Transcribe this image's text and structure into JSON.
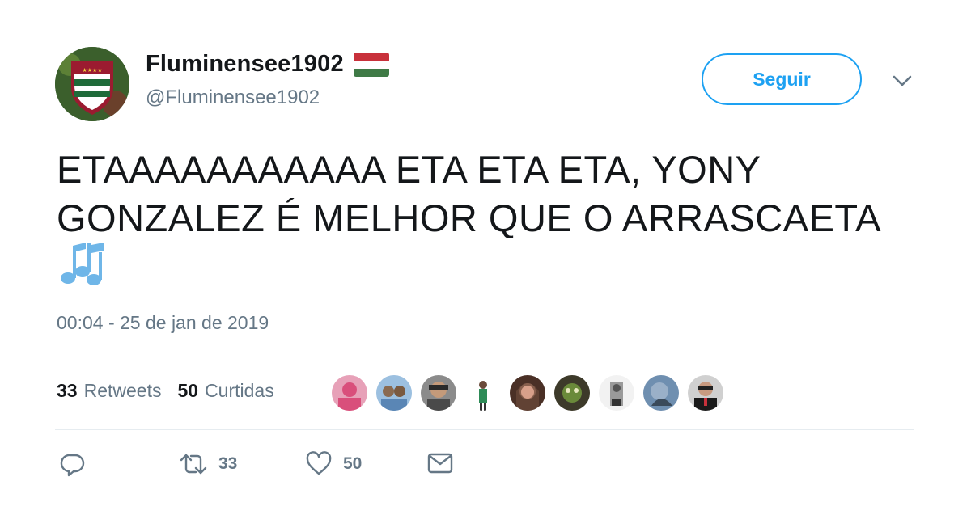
{
  "author": {
    "display_name": "Fluminensee1902",
    "handle": "@Fluminensee1902",
    "avatar_icon": "fluminense-crest-icon",
    "flag_icon": "hungary-flag-icon"
  },
  "follow_button": {
    "label": "Seguir"
  },
  "tweet": {
    "text_line_1": "ETAAAAAAAAAAA ETA ETA ETA, YONY",
    "text_line_2": "GONZALEZ É MELHOR QUE O ARRASCAETA",
    "emoji": "musical-notes-icon",
    "timestamp": "00:04 - 25 de jan de 2019"
  },
  "stats": {
    "retweets_count": "33",
    "retweets_label": "Retweets",
    "likes_count": "50",
    "likes_label": "Curtidas"
  },
  "likers": [
    {
      "name": "liker-avatar-1",
      "color": "#d94f7b"
    },
    {
      "name": "liker-avatar-2",
      "color": "#5a86b5"
    },
    {
      "name": "liker-avatar-3",
      "color": "#4a4a4a"
    },
    {
      "name": "liker-avatar-4",
      "color": "#2e8b57"
    },
    {
      "name": "liker-avatar-5",
      "color": "#6b4a3a"
    },
    {
      "name": "liker-avatar-6",
      "color": "#3d3a2a"
    },
    {
      "name": "liker-avatar-7",
      "color": "#bfbfbf"
    },
    {
      "name": "liker-avatar-8",
      "color": "#6f8fb0"
    },
    {
      "name": "liker-avatar-9",
      "color": "#555555"
    }
  ],
  "actions": {
    "reply_icon": "reply-icon",
    "retweet_icon": "retweet-icon",
    "retweet_count": "33",
    "like_icon": "heart-icon",
    "like_count": "50",
    "dm_icon": "envelope-icon"
  },
  "colors": {
    "accent": "#1da1f2",
    "text": "#14171a",
    "secondary_text": "#657786",
    "divider": "#e6ecf0"
  }
}
